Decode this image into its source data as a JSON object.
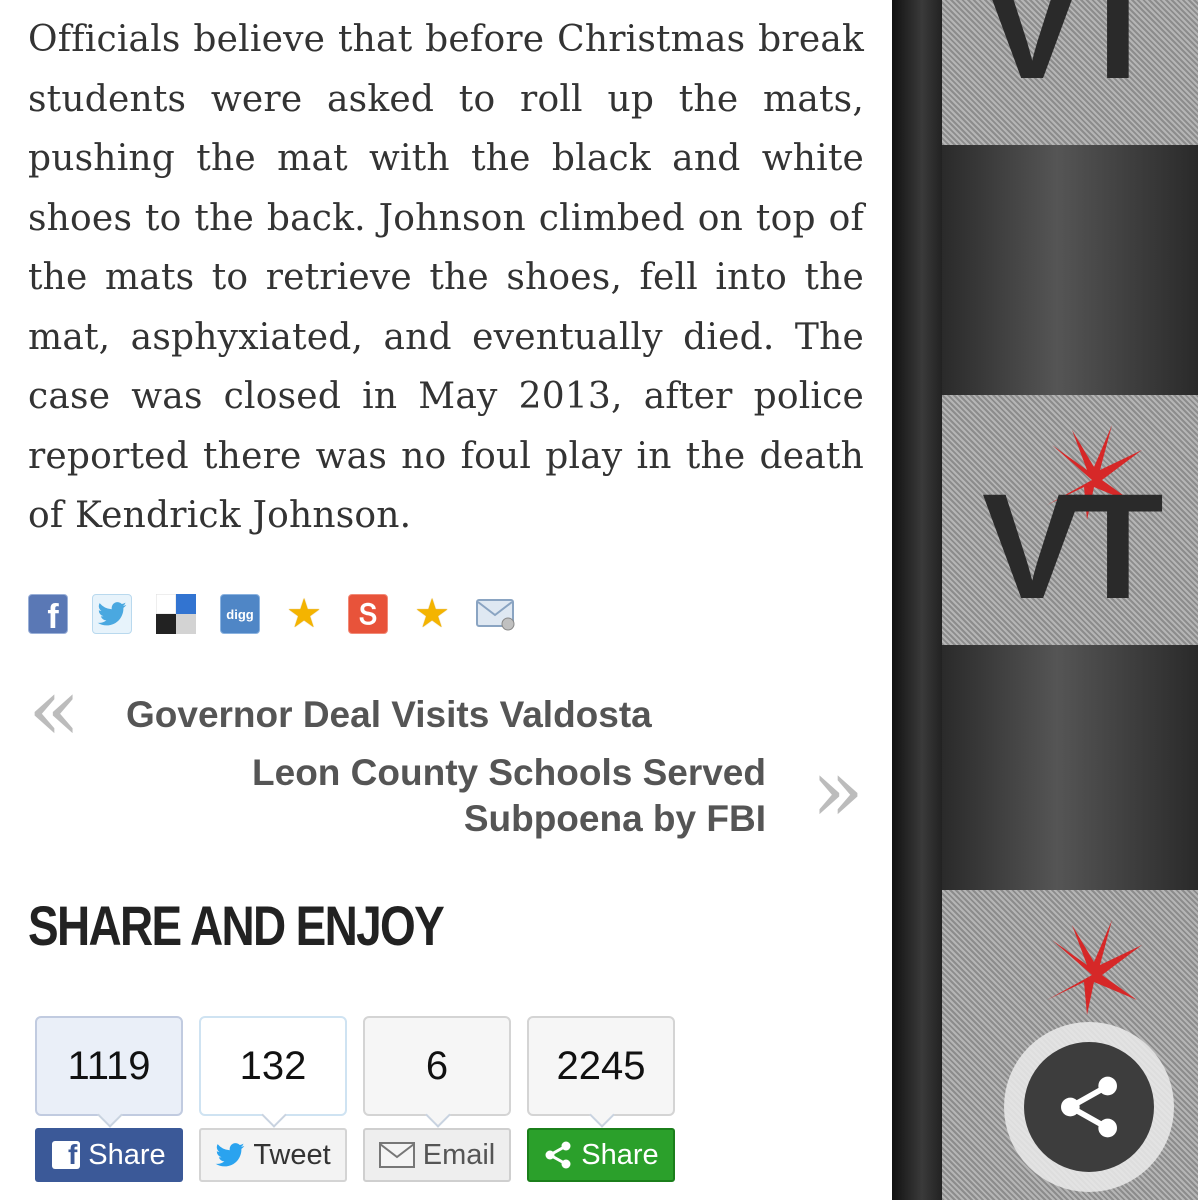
{
  "article": {
    "paragraph": "Officials believe that before Christmas break students were asked to roll up the mats, pushing the mat with the black and white shoes to the back. Johnson climbed on top of the mats to retrieve the shoes, fell into the mat, asphyxiated, and eventually died. The case was closed in May 2013, after police reported there was no foul play in the death of Kendrick Johnson."
  },
  "share_icons": [
    {
      "icon": "facebook-icon",
      "glyph": "f"
    },
    {
      "icon": "twitter-icon",
      "glyph": "🐦"
    },
    {
      "icon": "delicious-icon"
    },
    {
      "icon": "digg-icon",
      "glyph": "digg"
    },
    {
      "icon": "star-icon",
      "glyph": "★"
    },
    {
      "icon": "stumbleupon-icon",
      "glyph": "Տ"
    },
    {
      "icon": "star-icon",
      "glyph": "★"
    },
    {
      "icon": "email-icon"
    }
  ],
  "post_nav": {
    "prev_arrow": "«",
    "prev_title": "Governor Deal Visits Valdosta",
    "next_title": "Leon County Schools Served Subpoena by FBI",
    "next_arrow": "»"
  },
  "share_section": {
    "heading": "SHARE AND ENJOY",
    "widgets": [
      {
        "count": "1119",
        "label": "Share",
        "network": "facebook"
      },
      {
        "count": "132",
        "label": "Tweet",
        "network": "twitter"
      },
      {
        "count": "6",
        "label": "Email",
        "network": "email"
      },
      {
        "count": "2245",
        "label": "Share",
        "network": "share"
      }
    ]
  },
  "sidebar": {
    "logo_text": "VT",
    "accent_color": "#d62828"
  },
  "fab": {
    "icon": "share-icon"
  }
}
